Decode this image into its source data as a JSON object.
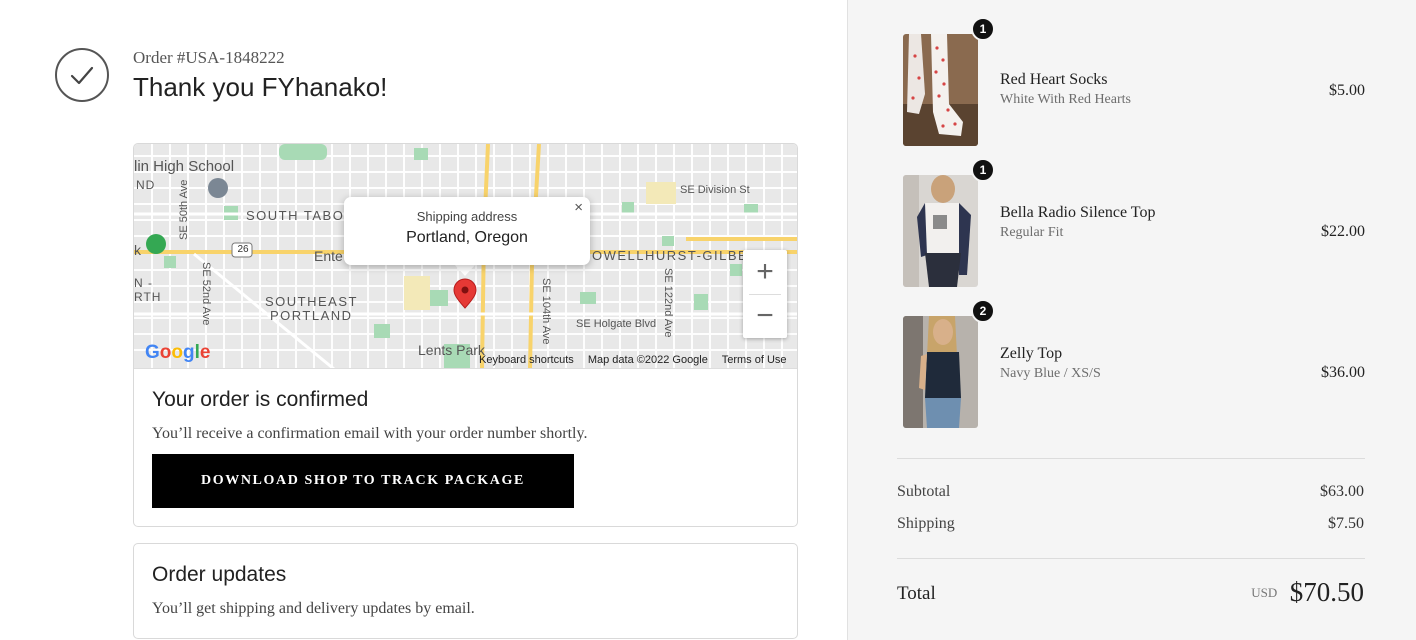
{
  "order": {
    "number": "Order #USA-1848222",
    "greeting": "Thank you FYhanako!"
  },
  "map": {
    "labels": {
      "school": "lin High School",
      "nd": "ND",
      "south_tabor": "SOUTH TABO",
      "se_division": "SE Division St",
      "se50": "SE 50th Ave",
      "se52": "SE 52nd Ave",
      "route": "26",
      "ente": "Ente",
      "k": "k",
      "n_rth": "N -",
      "rth": "RTH",
      "southeast": "SOUTHEAST",
      "portland": "PORTLAND",
      "powellhurst": "OWELLHURST-GILBEI",
      "se104": "SE 104th Ave",
      "se122": "SE 122nd Ave",
      "se_holgate": "SE Holgate Blvd",
      "lents_park": "Lents Park"
    },
    "popup": {
      "label": "Shipping address",
      "value": "Portland, Oregon",
      "close": "×"
    },
    "zoom_in": "+",
    "zoom_out": "−",
    "google": "Google",
    "attribution": {
      "shortcuts": "Keyboard shortcuts",
      "data": "Map data ©2022 Google",
      "terms": "Terms of Use"
    }
  },
  "confirmed": {
    "title": "Your order is confirmed",
    "body": "You’ll receive a confirmation email with your order number shortly.",
    "button": "DOWNLOAD SHOP TO TRACK PACKAGE"
  },
  "updates": {
    "title": "Order updates",
    "body": "You’ll get shipping and delivery updates by email."
  },
  "items": [
    {
      "qty": "1",
      "name": "Red Heart Socks",
      "variant": "White With Red Hearts",
      "price": "$5.00"
    },
    {
      "qty": "1",
      "name": "Bella Radio Silence Top",
      "variant": "Regular Fit",
      "price": "$22.00"
    },
    {
      "qty": "2",
      "name": "Zelly Top",
      "variant": "Navy Blue / XS/S",
      "price": "$36.00"
    }
  ],
  "summary": {
    "subtotal_label": "Subtotal",
    "subtotal_value": "$63.00",
    "shipping_label": "Shipping",
    "shipping_value": "$7.50",
    "total_label": "Total",
    "currency": "USD",
    "total_value": "$70.50"
  },
  "colors": {
    "button_bg": "#000000",
    "map_pin": "#e53935",
    "sidebar_bg": "#f5f5f5"
  }
}
